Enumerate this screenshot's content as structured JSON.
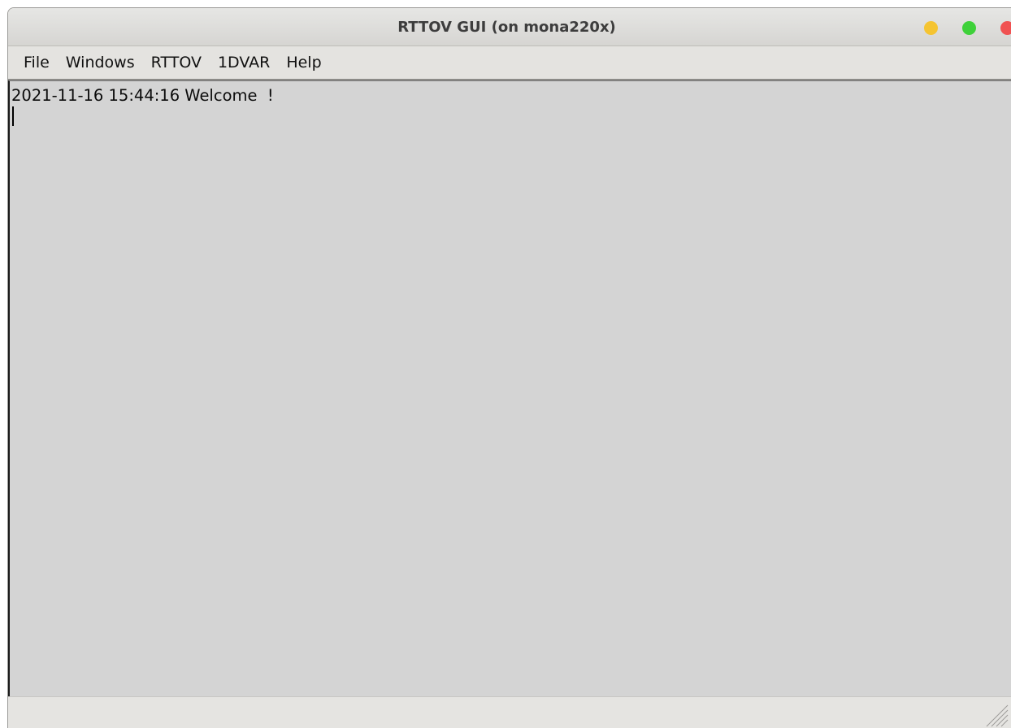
{
  "window": {
    "title": "RTTOV GUI (on mona220x)"
  },
  "menubar": {
    "items": [
      {
        "label": "File"
      },
      {
        "label": "Windows"
      },
      {
        "label": "RTTOV"
      },
      {
        "label": "1DVAR"
      },
      {
        "label": "Help"
      }
    ]
  },
  "log": {
    "lines": [
      "2021-11-16 15:44:16 Welcome  !"
    ]
  },
  "colors": {
    "minimize": "#f5c431",
    "maximize": "#3fd13a",
    "close": "#f05252",
    "log_background": "#d4d4d4"
  },
  "icons": {
    "minimize": "minimize-icon",
    "maximize": "maximize-icon",
    "close": "close-icon",
    "resize": "resize-grip-icon"
  }
}
